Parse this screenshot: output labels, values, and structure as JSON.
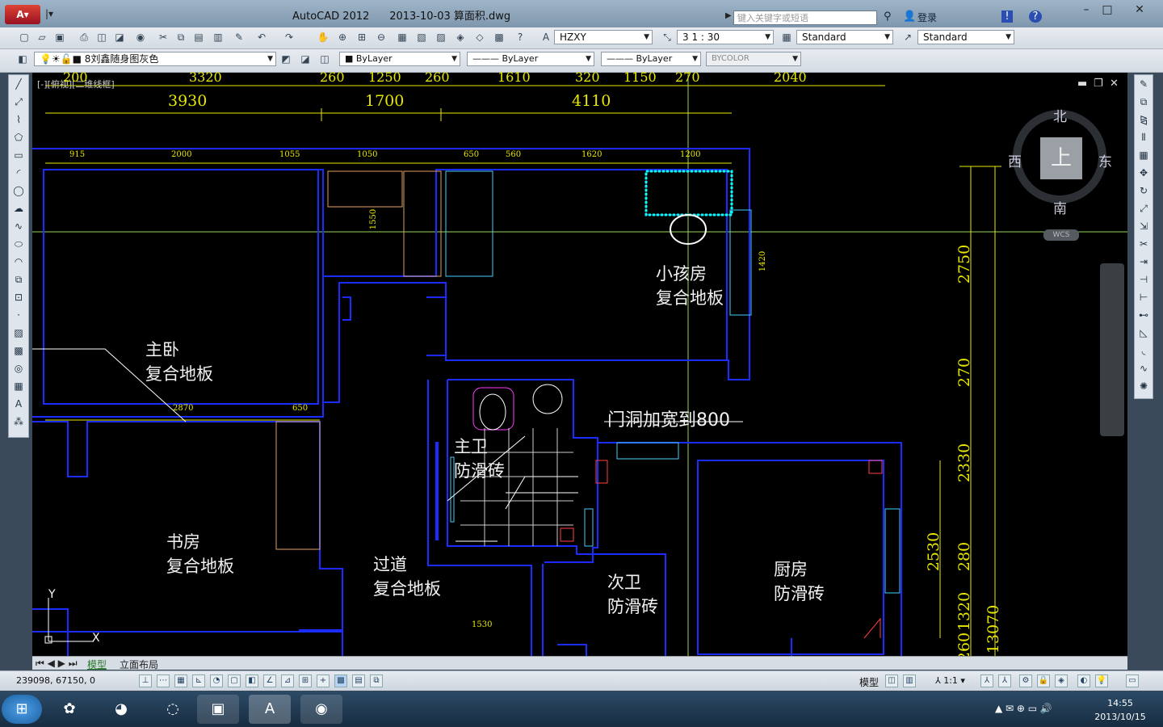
{
  "titlebar": {
    "app_version": "AutoCAD 2012",
    "file_name": "2013-10-03 算面积.dwg",
    "search_placeholder": "键入关键字或短语",
    "login_label": "登录"
  },
  "toolbar1": {
    "text_style": "HZXY",
    "scale": "3 1 : 30",
    "dim_style": "Standard",
    "table_style": "Standard"
  },
  "toolbar2": {
    "layer": "8刘鑫随身图灰色",
    "color": "ByLayer",
    "linetype": "ByLayer",
    "lineweight": "ByLayer",
    "plotstyle": "BYCOLOR"
  },
  "viewport": {
    "label": "[-][俯视][二维线框]",
    "compass": {
      "north": "北",
      "south": "南",
      "east": "东",
      "west": "西",
      "center": "上"
    },
    "wcs": "WCS"
  },
  "drawing": {
    "dims_top_cut": [
      "200",
      "3320",
      "260",
      "1250",
      "260",
      "1610",
      "320",
      "1150",
      "270",
      "2040"
    ],
    "dims_top": [
      "3930",
      "1700",
      "4110"
    ],
    "dims_second": [
      "915",
      "2000",
      "1055",
      "1050",
      "650",
      "560",
      "1620",
      "1200"
    ],
    "dims_misc": [
      "1550",
      "1420",
      "2870",
      "650",
      "1530"
    ],
    "dims_right_outer": [
      "2750",
      "270",
      "2330",
      "280",
      "1320",
      "260"
    ],
    "dims_right_inner": [
      "2530"
    ],
    "dim_total_right": "13070",
    "note": "门洞加宽到800",
    "rooms": {
      "child": {
        "name": "小孩房",
        "floor": "复合地板"
      },
      "master": {
        "name": "主卧",
        "floor": "复合地板"
      },
      "study": {
        "name": "书房",
        "floor": "复合地板"
      },
      "hall": {
        "name": "过道",
        "floor": "复合地板"
      },
      "master_bath": {
        "name": "主卫",
        "floor": "防滑砖"
      },
      "second_bath": {
        "name": "次卫",
        "floor": "防滑砖"
      },
      "kitchen": {
        "name": "厨房",
        "floor": "防滑砖"
      }
    }
  },
  "tabs": {
    "model": "模型",
    "layout": "立面布局"
  },
  "status": {
    "coords": "239098, 67150, 0",
    "model_label": "模型",
    "annot_scale": "1:1"
  },
  "taskbar": {
    "time": "14:55",
    "date": "2013/10/15"
  }
}
